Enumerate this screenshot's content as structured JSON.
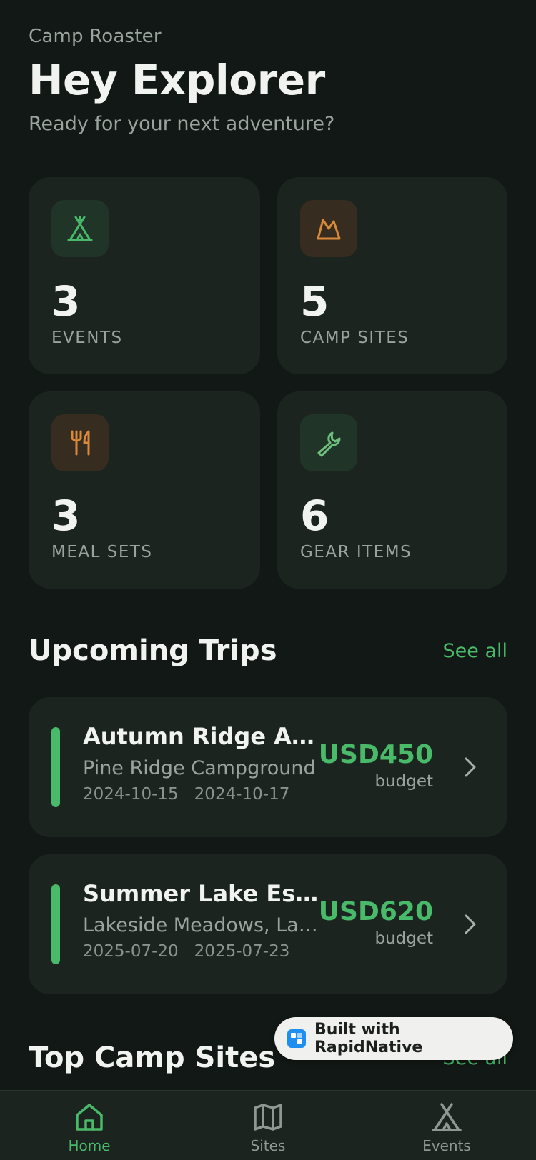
{
  "header": {
    "app_name": "Camp Roaster",
    "greeting": "Hey Explorer",
    "tagline": "Ready for your next adventure?"
  },
  "stats": [
    {
      "value": "3",
      "label": "EVENTS",
      "icon": "tent-icon"
    },
    {
      "value": "5",
      "label": "CAMP SITES",
      "icon": "mountain-icon"
    },
    {
      "value": "3",
      "label": "MEAL SETS",
      "icon": "utensils-icon"
    },
    {
      "value": "6",
      "label": "GEAR ITEMS",
      "icon": "wrench-icon"
    }
  ],
  "upcoming": {
    "title": "Upcoming Trips",
    "see_all": "See all",
    "trips": [
      {
        "name": "Autumn Ridge Adventure",
        "location": "Pine Ridge Campground",
        "start": "2024-10-15",
        "end": "2024-10-17",
        "budget": "USD450",
        "budget_label": "budget"
      },
      {
        "name": "Summer Lake Escape",
        "location": "Lakeside Meadows, Lake",
        "start": "2025-07-20",
        "end": "2025-07-23",
        "budget": "USD620",
        "budget_label": "budget"
      }
    ]
  },
  "top_sites": {
    "title": "Top Camp Sites",
    "see_all": "See all"
  },
  "badge": {
    "text": "Built with RapidNative"
  },
  "tabs": [
    {
      "label": "Home",
      "icon": "home-icon",
      "active": true
    },
    {
      "label": "Sites",
      "icon": "map-icon",
      "active": false
    },
    {
      "label": "Events",
      "icon": "tent-icon",
      "active": false
    }
  ],
  "colors": {
    "background": "#121815",
    "card": "#1c241f",
    "accent": "#49b96a",
    "amber": "#d9893a"
  }
}
